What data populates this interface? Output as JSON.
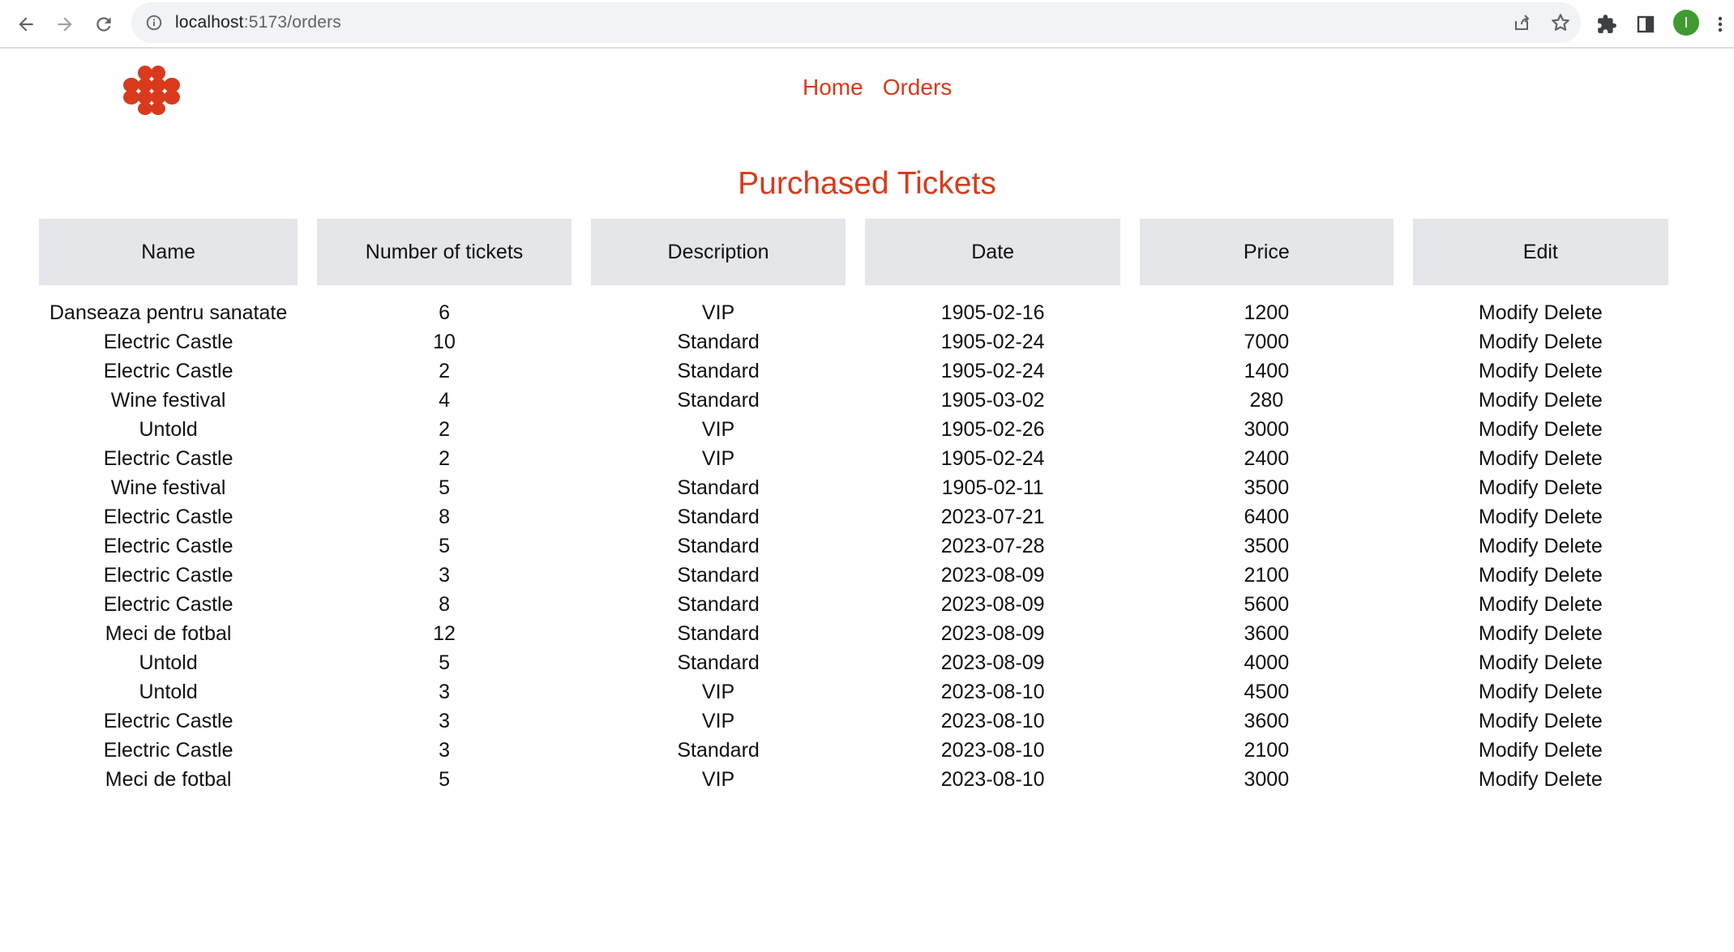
{
  "browser": {
    "url_host": "localhost",
    "url_path": ":5173/orders",
    "avatar_letter": "I"
  },
  "icons": {
    "back": "back-arrow-icon",
    "forward": "forward-arrow-icon",
    "reload": "reload-icon",
    "info": "info-icon",
    "share": "share-icon",
    "star": "star-icon",
    "extensions": "puzzle-icon",
    "side_panel": "side-panel-icon",
    "menu": "kebab-menu-icon",
    "logo": "flower-logo-icon"
  },
  "colors": {
    "accent": "#d93a1c",
    "header_bg": "#e5e6ea",
    "avatar": "#3f9b30"
  },
  "nav": {
    "home": "Home",
    "orders": "Orders"
  },
  "page_title": "Purchased Tickets",
  "table": {
    "headers": [
      "Name",
      "Number of tickets",
      "Description",
      "Date",
      "Price",
      "Edit"
    ],
    "modify_label": "Modify",
    "delete_label": "Delete",
    "rows": [
      [
        "Danseaza pentru sanatate",
        "6",
        "VIP",
        "1905-02-16",
        "1200"
      ],
      [
        "Electric Castle",
        "10",
        "Standard",
        "1905-02-24",
        "7000"
      ],
      [
        "Electric Castle",
        "2",
        "Standard",
        "1905-02-24",
        "1400"
      ],
      [
        "Wine festival",
        "4",
        "Standard",
        "1905-03-02",
        "280"
      ],
      [
        "Untold",
        "2",
        "VIP",
        "1905-02-26",
        "3000"
      ],
      [
        "Electric Castle",
        "2",
        "VIP",
        "1905-02-24",
        "2400"
      ],
      [
        "Wine festival",
        "5",
        "Standard",
        "1905-02-11",
        "3500"
      ],
      [
        "Electric Castle",
        "8",
        "Standard",
        "2023-07-21",
        "6400"
      ],
      [
        "Electric Castle",
        "5",
        "Standard",
        "2023-07-28",
        "3500"
      ],
      [
        "Electric Castle",
        "3",
        "Standard",
        "2023-08-09",
        "2100"
      ],
      [
        "Electric Castle",
        "8",
        "Standard",
        "2023-08-09",
        "5600"
      ],
      [
        "Meci de fotbal",
        "12",
        "Standard",
        "2023-08-09",
        "3600"
      ],
      [
        "Untold",
        "5",
        "Standard",
        "2023-08-09",
        "4000"
      ],
      [
        "Untold",
        "3",
        "VIP",
        "2023-08-10",
        "4500"
      ],
      [
        "Electric Castle",
        "3",
        "VIP",
        "2023-08-10",
        "3600"
      ],
      [
        "Electric Castle",
        "3",
        "Standard",
        "2023-08-10",
        "2100"
      ],
      [
        "Meci de fotbal",
        "5",
        "VIP",
        "2023-08-10",
        "3000"
      ]
    ]
  }
}
